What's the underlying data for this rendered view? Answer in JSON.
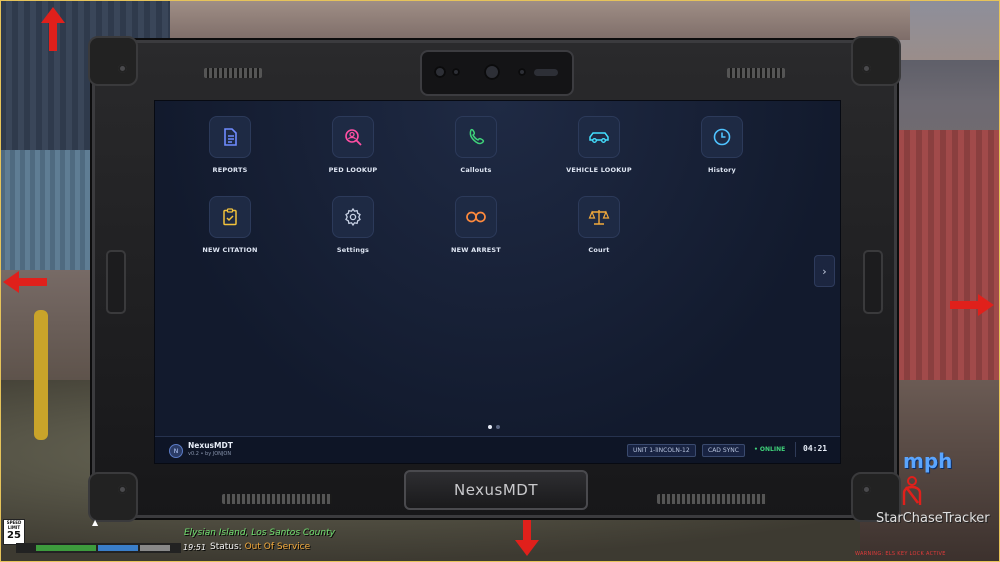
{
  "mdt": {
    "brand_name": "NexusMDT",
    "brand_version": "v0.2 • by JONJON",
    "brand_logo_text": "N",
    "nameplate": "NexusMDT",
    "unit": "UNIT 1-lINCOLN-12",
    "cad": "CAD SYNC",
    "online": "• ONLINE",
    "clock": "04:21",
    "next": "›",
    "apps": [
      {
        "label": "REPORTS",
        "icon": "document-icon",
        "color": "#6f8bff"
      },
      {
        "label": "PED LOOKUP",
        "icon": "person-search-icon",
        "color": "#ff4fa3"
      },
      {
        "label": "Callouts",
        "icon": "phone-icon",
        "color": "#3fd27a"
      },
      {
        "label": "VEHICLE LOOKUP",
        "icon": "car-icon",
        "color": "#43e0ff"
      },
      {
        "label": "History",
        "icon": "clock-icon",
        "color": "#4fc3ff"
      },
      {
        "label": "NEW CITATION",
        "icon": "clipboard-check-icon",
        "color": "#f2c23b"
      },
      {
        "label": "Settings",
        "icon": "gear-icon",
        "color": "#c9d3e6"
      },
      {
        "label": "NEW ARREST",
        "icon": "handcuffs-icon",
        "color": "#ff8a3d"
      },
      {
        "label": "Court",
        "icon": "scales-icon",
        "color": "#f2a93b"
      }
    ],
    "page_dots": 2,
    "active_page": 1
  },
  "hud": {
    "speed_limit_label": "SPEED LIMIT",
    "speed_limit": "25",
    "location": "Elysian Island, Los Santos County",
    "time": "19:51",
    "status_label": "Status:",
    "status_value": "Out Of Service",
    "speed_unit": "mph",
    "tracker": "StarChaseTracker",
    "warning": "WARNING: ELS KEY LOCK ACTIVE"
  },
  "colors": {
    "arrow": "#e0201b",
    "accent": "#2c3a5a",
    "screen_bg": "#121a2d"
  }
}
